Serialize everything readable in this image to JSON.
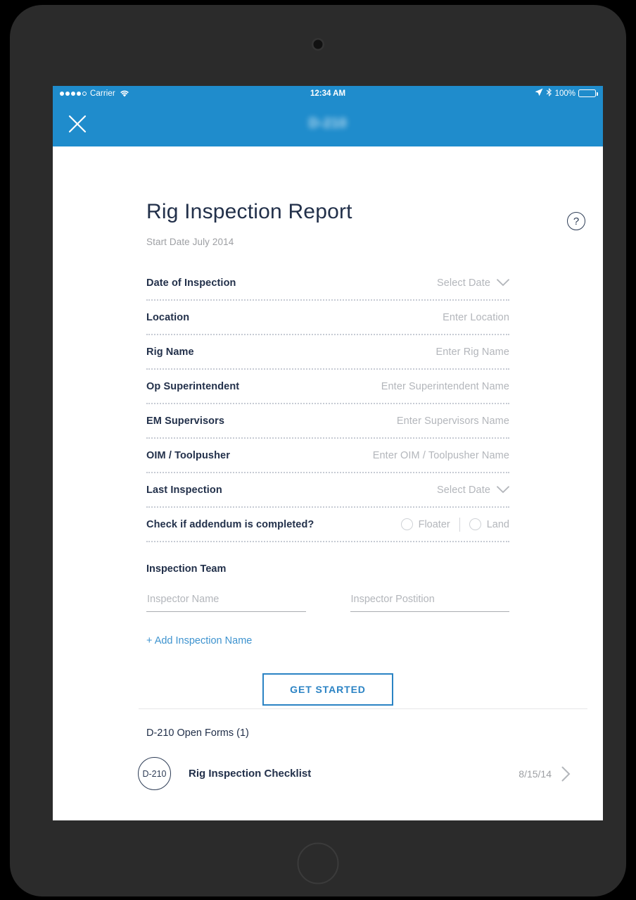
{
  "device": {
    "camera": "camera-icon",
    "home_button": "home-button"
  },
  "status_bar": {
    "signal_dots_filled": 4,
    "signal_dots_empty": 1,
    "carrier": "Carrier",
    "wifi_icon": "wifi-icon",
    "time": "12:34 AM",
    "location_icon": "location-arrow-icon",
    "bluetooth_icon": "bluetooth-icon",
    "battery_percent": "100%",
    "battery_icon": "battery-full-icon"
  },
  "nav_bar": {
    "close_icon": "close-icon",
    "title": "D-210",
    "background_color": "#1f8ccc"
  },
  "header": {
    "title": "Rig Inspection Report",
    "subtitle": "Start Date July 2014",
    "help_icon": "help-circle-icon",
    "help_glyph": "?"
  },
  "fields": [
    {
      "label": "Date of Inspection",
      "value": "Select Date",
      "type": "date",
      "icon": "chevron-down-icon"
    },
    {
      "label": "Location",
      "value": "Enter Location",
      "type": "text"
    },
    {
      "label": "Rig Name",
      "value": "Enter Rig Name",
      "type": "text"
    },
    {
      "label": "Op Superintendent",
      "value": "Enter Superintendent Name",
      "type": "text"
    },
    {
      "label": "EM Supervisors",
      "value": "Enter Supervisors Name",
      "type": "text"
    },
    {
      "label": "OIM / Toolpusher",
      "value": "Enter OIM / Toolpusher Name",
      "type": "text"
    },
    {
      "label": "Last Inspection",
      "value": "Select Date",
      "type": "date",
      "icon": "chevron-down-icon"
    }
  ],
  "addendum": {
    "label": "Check if addendum is completed?",
    "options": [
      {
        "label": "Floater",
        "selected": false
      },
      {
        "label": "Land",
        "selected": false
      }
    ]
  },
  "inspection_team": {
    "label": "Inspection Team",
    "name_placeholder": "Inspector Name",
    "name_value": "",
    "position_placeholder": "Inspector Postition",
    "position_value": "",
    "add_link": "+ Add Inspection Name"
  },
  "primary_action": {
    "label": "GET STARTED",
    "color": "#2b83c4"
  },
  "open_forms": {
    "title": "D-210 Open Forms (1)",
    "rows": [
      {
        "badge": "D-210",
        "name": "Rig Inspection Checklist",
        "date": "8/15/14",
        "chevron": "chevron-right-icon"
      }
    ]
  },
  "colors": {
    "accent_blue": "#1f8ccc",
    "link_blue": "#3e93cf",
    "text_dark": "#22304a",
    "text_muted": "#b3b6bb",
    "device_bezel": "#2b2b2b"
  }
}
